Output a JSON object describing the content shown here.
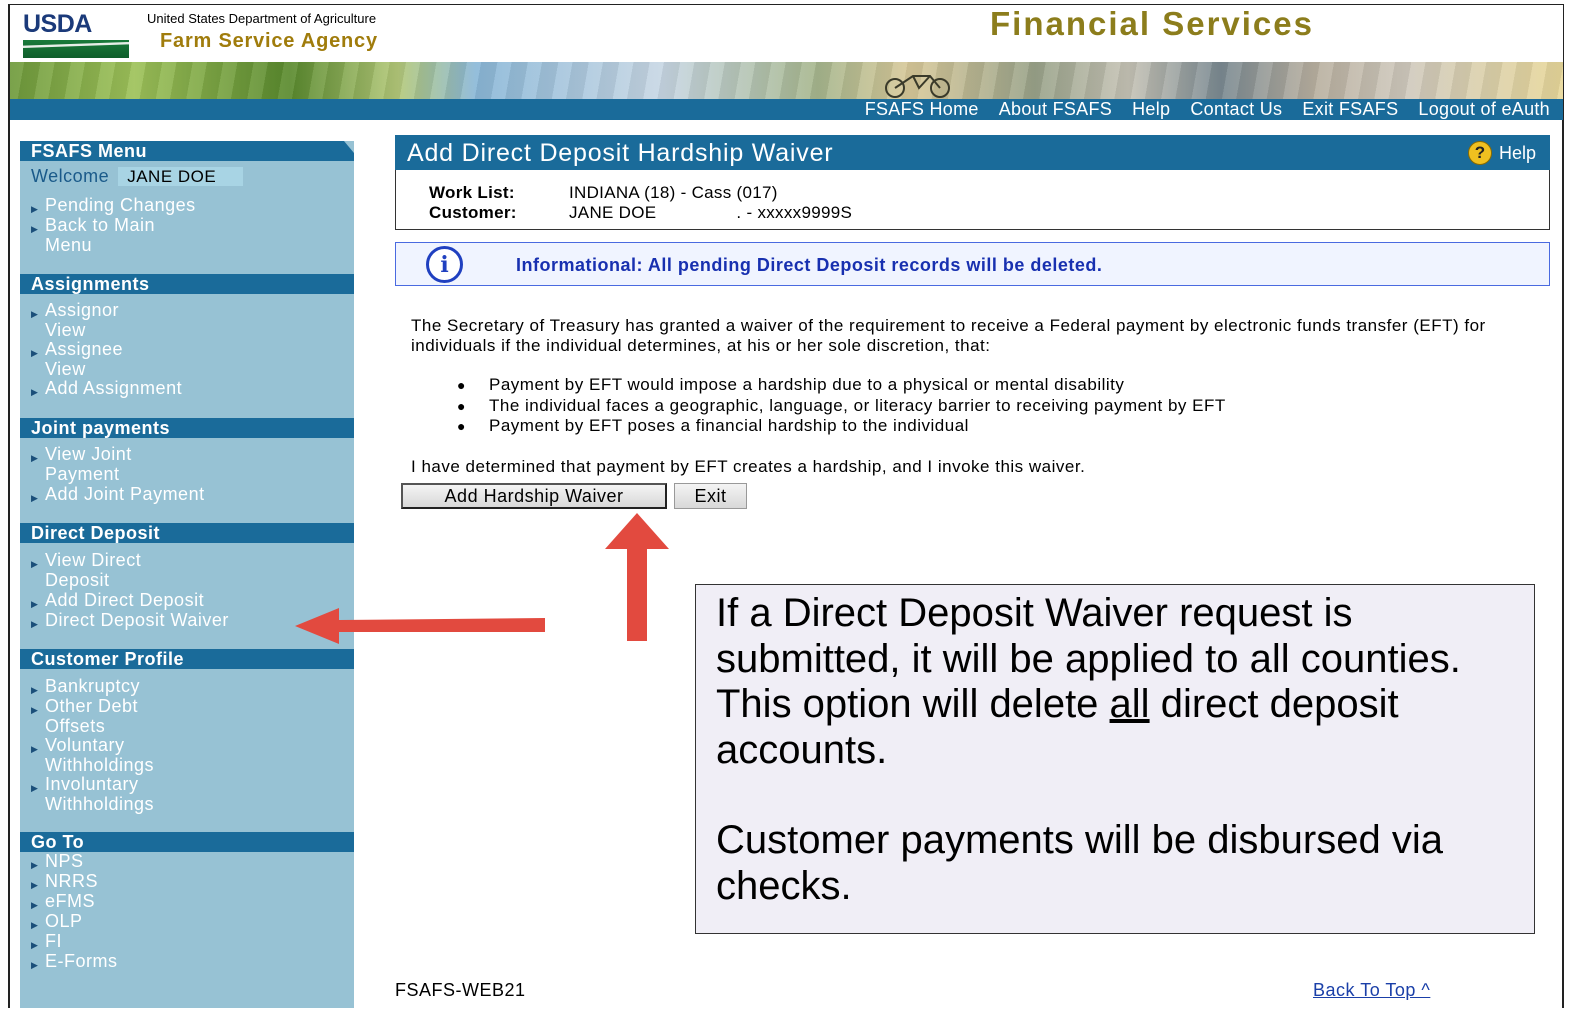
{
  "header": {
    "logo_text": "USDA",
    "department": "United States Department of Agriculture",
    "agency": "Farm Service Agency",
    "app_title": "Financial Services"
  },
  "top_nav": [
    {
      "label": "FSAFS Home"
    },
    {
      "label": "About FSAFS"
    },
    {
      "label": "Help"
    },
    {
      "label": "Contact Us"
    },
    {
      "label": "Exit FSAFS"
    },
    {
      "label": "Logout of eAuth"
    }
  ],
  "sidebar": {
    "menu_heading": "FSAFS Menu",
    "welcome_label": "Welcome",
    "welcome_name": "JANE DOE",
    "menu_items": [
      "Pending Changes",
      "Back to Main\nMenu"
    ],
    "sections": [
      {
        "heading": "Assignments",
        "items": [
          "Assignor\nView",
          "Assignee\nView",
          "Add Assignment"
        ]
      },
      {
        "heading": "Joint payments",
        "items": [
          "View Joint\nPayment",
          "Add Joint Payment"
        ]
      },
      {
        "heading": "Direct Deposit",
        "items": [
          "View Direct\nDeposit",
          "Add Direct Deposit",
          "Direct Deposit Waiver"
        ]
      },
      {
        "heading": "Customer Profile",
        "items": [
          "Bankruptcy",
          "Other Debt\nOffsets",
          "Voluntary\nWithholdings",
          "Involuntary\nWithholdings"
        ]
      },
      {
        "heading": "Go To",
        "items": [
          "NPS",
          "NRRS",
          "eFMS",
          "OLP",
          "FI",
          "E-Forms"
        ]
      }
    ]
  },
  "page": {
    "title": "Add Direct Deposit Hardship Waiver",
    "help_label": "Help",
    "help_icon": "question-icon",
    "worklist_label": "Work List:",
    "worklist_value": "INDIANA (18) - Cass (017)",
    "customer_label": "Customer:",
    "customer_name": "JANE DOE",
    "customer_id": ". - xxxxx9999S",
    "alert_icon": "info-icon",
    "alert_text": "Informational: All pending Direct Deposit records will be deleted.",
    "intro": "The Secretary of Treasury has granted a waiver of the requirement to receive a Federal payment by electronic funds transfer (EFT) for individuals if the individual determines, at his or her sole discretion, that:",
    "bullets": [
      "Payment by EFT would impose a hardship due to a physical or mental disability",
      "The individual faces a geographic, language, or literacy barrier to receiving payment by EFT",
      "Payment by EFT poses a financial hardship to the individual"
    ],
    "determination": "I have determined that payment by EFT creates a hardship, and I invoke this waiver.",
    "add_button": "Add Hardship Waiver",
    "exit_button": "Exit",
    "footer_id": "FSAFS-WEB21",
    "back_to_top": "Back To Top ^"
  },
  "callout": {
    "line1_pre": "If a Direct Deposit Waiver request is submitted, it will be applied to all counties. This option will delete ",
    "line1_emph": "all",
    "line1_post": " direct deposit accounts.",
    "line2": "Customer payments will be disbursed via checks."
  },
  "colors": {
    "nav_blue": "#1a6b9a",
    "sidebar_bg": "#97c2d4",
    "title_gold": "#8c7d1c",
    "arrow_red": "#e24a3f",
    "alert_blue": "#1830b0"
  }
}
